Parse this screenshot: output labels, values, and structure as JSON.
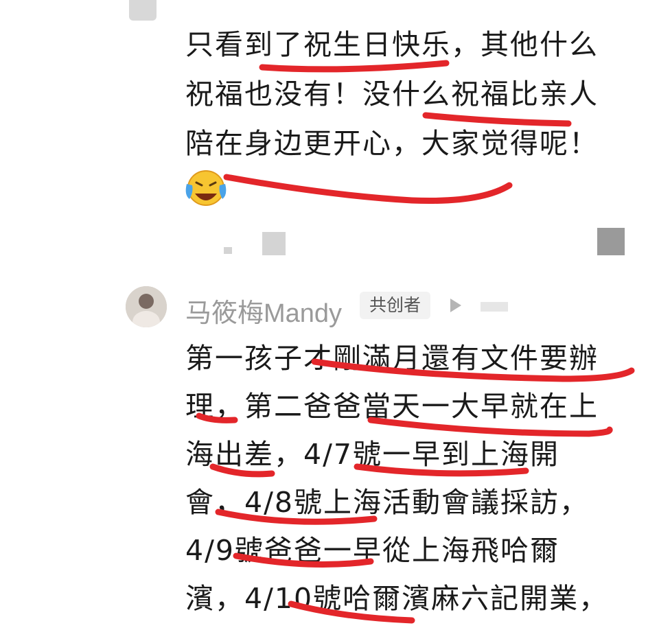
{
  "first_comment": {
    "lines": [
      "只看到了祝生日快乐，其他什么",
      "祝福也没有！没什么祝福比亲人",
      "陪在身边更开心，大家觉得呢！"
    ],
    "emoji": "crying-laughing-emoji"
  },
  "second_comment": {
    "username": "马筱梅Mandy",
    "badge": "共创者",
    "lines": [
      "第一孩子才剛滿月還有文件要辦",
      "理，第二爸爸當天一大早就在上",
      "海出差，4/7號一早到上海開",
      "會，4/8號上海活動會議採訪，",
      "4/9號爸爸一早從上海飛哈爾",
      "濱，4/10號哈爾濱麻六記開業，"
    ]
  },
  "colors": {
    "underline": "#e3262a",
    "text": "#1a1a1a",
    "username": "#9a9a9a",
    "badge_bg": "#f2f2f2"
  }
}
